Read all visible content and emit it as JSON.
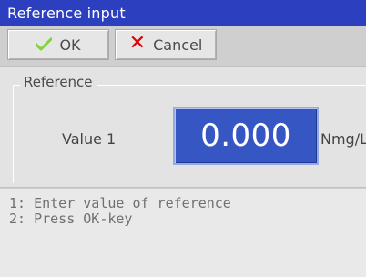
{
  "window": {
    "title": "Reference input"
  },
  "toolbar": {
    "ok_label": "OK",
    "cancel_label": "Cancel"
  },
  "reference_section": {
    "legend": "Reference",
    "value_label": "Value 1",
    "value": "0.000",
    "unit": "Nmg/L"
  },
  "messages": [
    "1: Enter value of reference",
    "2: Press OK-key"
  ],
  "colors": {
    "titlebar": "#2b3fbf",
    "value_display": "#3556c3",
    "ok_icon": "#7fd43a",
    "cancel_icon": "#e00000"
  },
  "icons": {
    "ok": "checkmark-icon",
    "cancel": "x-mark-icon"
  }
}
